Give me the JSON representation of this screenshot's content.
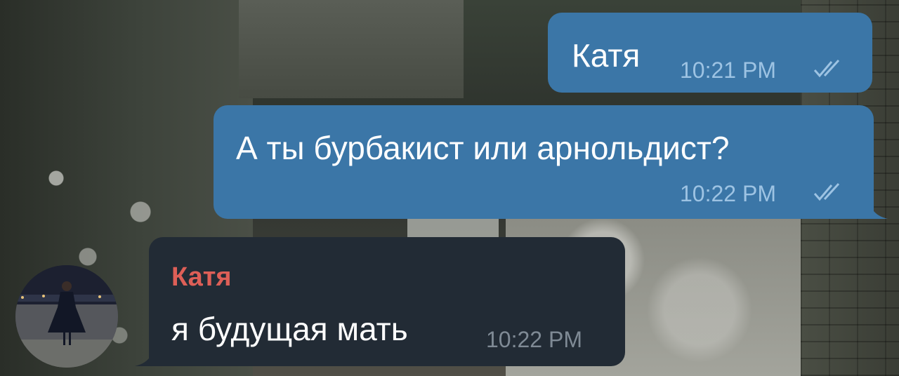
{
  "messages": [
    {
      "direction": "outgoing",
      "text": "Катя",
      "time": "10:21 PM",
      "status_icon": "double-check-icon"
    },
    {
      "direction": "outgoing",
      "text": "А ты бурбакист или арнольдист?",
      "time": "10:22 PM",
      "status_icon": "double-check-icon"
    },
    {
      "direction": "incoming",
      "sender": "Катя",
      "text": "я будущая мать",
      "time": "10:22 PM",
      "avatar_icon": "user-avatar"
    }
  ],
  "colors": {
    "outgoing_bubble": "#3b76a7",
    "incoming_bubble": "#222b35",
    "sender_name": "#de5f57",
    "outgoing_time": "#9dc3e3",
    "incoming_time": "#7f8a95"
  }
}
